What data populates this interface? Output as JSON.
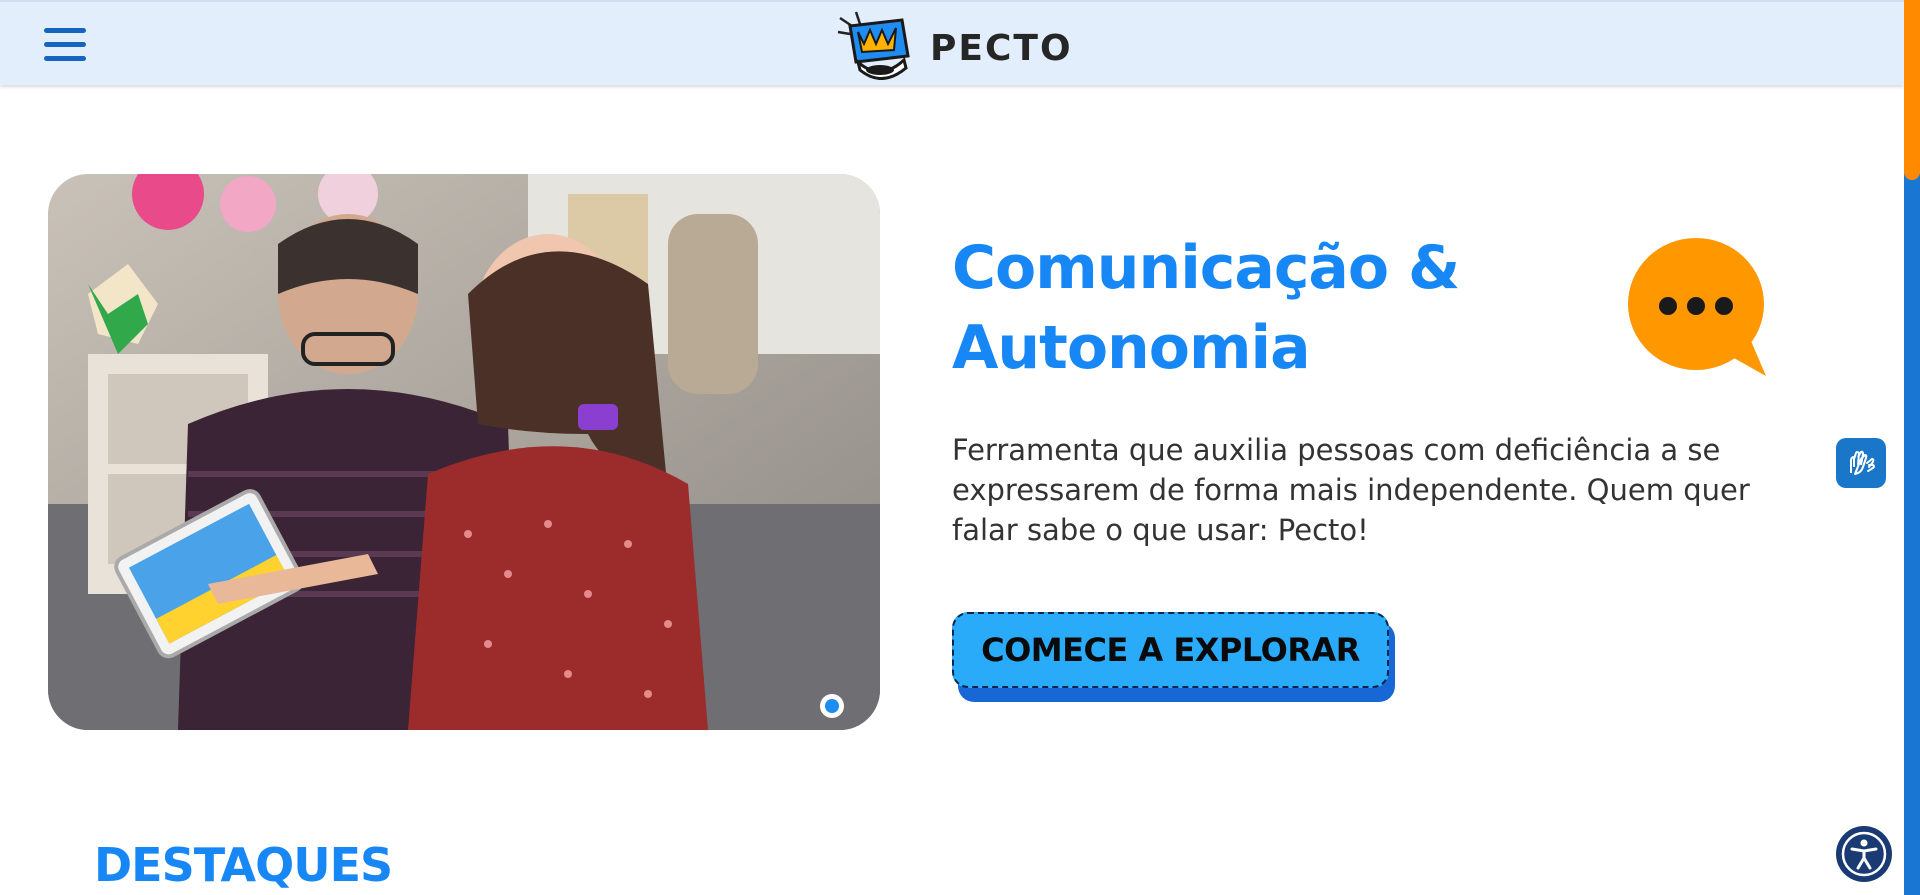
{
  "header": {
    "brand": "PECTO",
    "menu_icon": "hamburger-menu-icon",
    "logo_icon": "pecto-mascot-icon"
  },
  "hero": {
    "title_line1": "Comunicação &",
    "title_line2": "Autonomia",
    "description": "Ferramenta que auxilia pessoas com deficiência a se expressarem de forma mais independente. Quem quer falar sabe o que usar: Pecto!",
    "cta_label": "COMECE A EXPLORAR",
    "image_subject": "man and girl using a tablet",
    "bubble_icon": "speech-bubble-icon"
  },
  "sections": {
    "highlights_title": "DESTAQUES"
  },
  "widgets": {
    "sign_language_icon": "sign-language-hands-icon",
    "accessibility_icon": "accessibility-icon"
  },
  "colors": {
    "primary_blue": "#1787f5",
    "header_bg": "#e3eefd",
    "cta_bg": "#29abf9",
    "accent_orange": "#ff8a00",
    "menu_blue": "#1565c0"
  }
}
